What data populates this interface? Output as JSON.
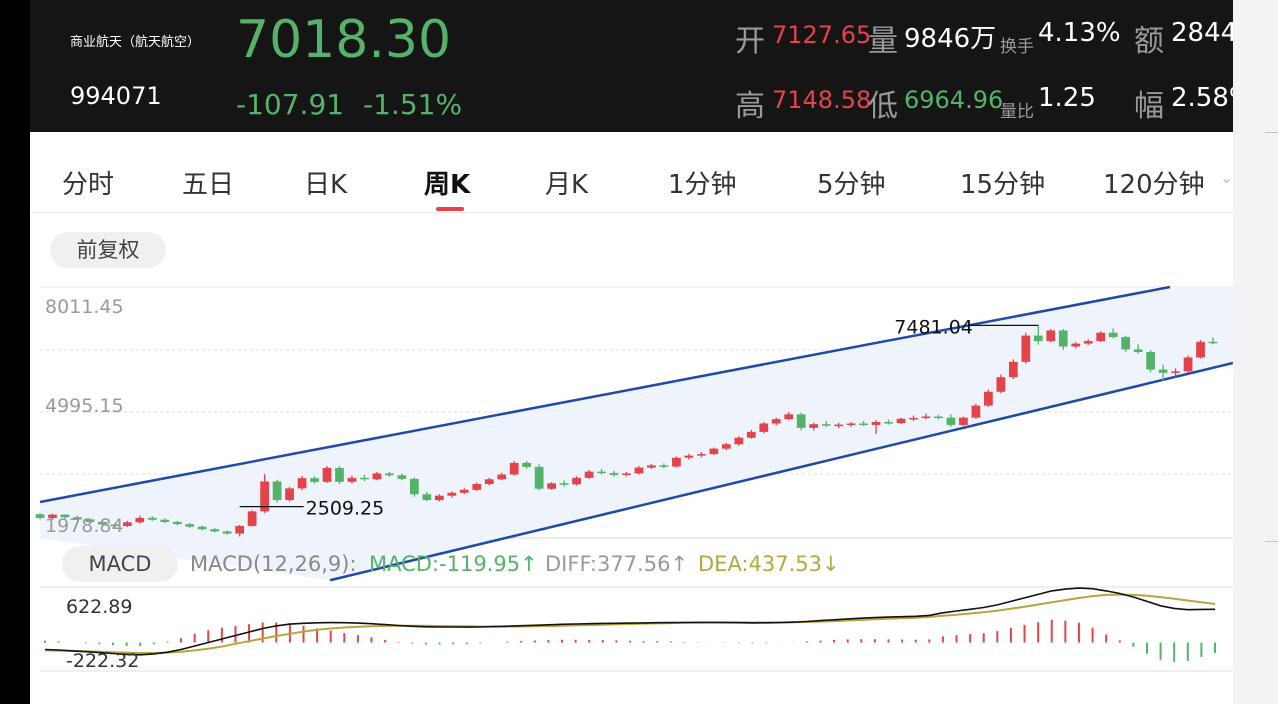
{
  "quote": {
    "name": "商业航天（航天航空）",
    "code": "994071",
    "price": "7018.30",
    "change_abs": "-107.91",
    "change_pct": "-1.51%",
    "open_label": "开",
    "open": "7127.65",
    "volume_label": "量",
    "volume": "9846万",
    "turnover_label": "换手",
    "turnover": "4.13%",
    "amount_label": "额",
    "amount": "2844",
    "high_label": "高",
    "high": "7148.58",
    "low_label": "低",
    "low": "6964.96",
    "ratio_label": "量比",
    "ratio": "1.25",
    "amplitude_label": "幅",
    "amplitude": "2.58%"
  },
  "tabs": [
    "分时",
    "五日",
    "日K",
    "周K",
    "月K",
    "1分钟",
    "5分钟",
    "15分钟",
    "120分钟"
  ],
  "active_tab": "周K",
  "adjust_label": "前复权",
  "kline": {
    "y_top_label": "8011.45",
    "y_mid_label": "4995.15",
    "y_bottom_label": "1978.84",
    "max_annotation": "7481.04",
    "min_annotation": "2509.25"
  },
  "macd": {
    "button_label": "MACD",
    "params": "MACD(12,26,9):",
    "macd_text": "MACD:-119.95↑",
    "diff_text": "DIFF:377.56↑",
    "dea_text": "DEA:437.53↓",
    "top_label": "622.89",
    "bottom_label": "-222.32"
  },
  "colors": {
    "up": "#e5434a",
    "down": "#54b369",
    "channel": "#1f4aa8",
    "channel_fill": "#eef3fc",
    "dea": "#b8a63a",
    "diff": "#111111"
  },
  "chart_data": [
    {
      "type": "candlestick",
      "period": "weekly",
      "y_ticks": [
        8011.45,
        4995.15,
        1978.84
      ],
      "ohlc": [
        [
          2300,
          2330,
          2160,
          2200
        ],
        [
          2200,
          2320,
          2150,
          2290
        ],
        [
          2290,
          2300,
          2180,
          2220
        ],
        [
          2220,
          2260,
          2120,
          2160
        ],
        [
          2160,
          2190,
          2050,
          2090
        ],
        [
          2090,
          2120,
          1990,
          2020
        ],
        [
          2020,
          2060,
          1940,
          1980
        ],
        [
          1980,
          2120,
          1950,
          2080
        ],
        [
          2080,
          2260,
          2040,
          2200
        ],
        [
          2200,
          2250,
          2120,
          2150
        ],
        [
          2150,
          2190,
          2060,
          2090
        ],
        [
          2090,
          2120,
          2000,
          2030
        ],
        [
          2030,
          2060,
          1930,
          1960
        ],
        [
          1960,
          1990,
          1860,
          1890
        ],
        [
          1890,
          1920,
          1800,
          1830
        ],
        [
          1830,
          1860,
          1740,
          1770
        ],
        [
          1770,
          2010,
          1690,
          1980
        ],
        [
          1980,
          2410,
          1960,
          2380
        ],
        [
          2380,
          3400,
          2330,
          3200
        ],
        [
          3200,
          3250,
          2620,
          2690
        ],
        [
          2690,
          3050,
          2650,
          3010
        ],
        [
          3010,
          3350,
          2960,
          3290
        ],
        [
          3290,
          3340,
          3140,
          3190
        ],
        [
          3190,
          3620,
          3160,
          3570
        ],
        [
          3570,
          3620,
          3130,
          3190
        ],
        [
          3190,
          3360,
          3140,
          3300
        ],
        [
          3300,
          3380,
          3210,
          3260
        ],
        [
          3260,
          3460,
          3230,
          3420
        ],
        [
          3420,
          3470,
          3330,
          3370
        ],
        [
          3370,
          3420,
          3230,
          3270
        ],
        [
          3270,
          3310,
          2780,
          2850
        ],
        [
          2850,
          2910,
          2660,
          2690
        ],
        [
          2690,
          2850,
          2650,
          2810
        ],
        [
          2810,
          2930,
          2760,
          2890
        ],
        [
          2890,
          3010,
          2850,
          2970
        ],
        [
          2970,
          3170,
          2940,
          3130
        ],
        [
          3130,
          3300,
          3090,
          3260
        ],
        [
          3260,
          3440,
          3230,
          3390
        ],
        [
          3390,
          3760,
          3360,
          3710
        ],
        [
          3710,
          3760,
          3550,
          3600
        ],
        [
          3600,
          3670,
          2960,
          3000
        ],
        [
          3000,
          3180,
          2970,
          3150
        ],
        [
          3150,
          3230,
          3060,
          3120
        ],
        [
          3120,
          3340,
          3090,
          3300
        ],
        [
          3300,
          3520,
          3270,
          3470
        ],
        [
          3470,
          3540,
          3390,
          3430
        ],
        [
          3430,
          3490,
          3330,
          3380
        ],
        [
          3380,
          3460,
          3340,
          3420
        ],
        [
          3420,
          3620,
          3390,
          3580
        ],
        [
          3580,
          3680,
          3540,
          3640
        ],
        [
          3640,
          3700,
          3560,
          3610
        ],
        [
          3610,
          3890,
          3580,
          3850
        ],
        [
          3850,
          3960,
          3800,
          3910
        ],
        [
          3910,
          4010,
          3860,
          3950
        ],
        [
          3950,
          4130,
          3920,
          4100
        ],
        [
          4100,
          4260,
          4060,
          4220
        ],
        [
          4220,
          4440,
          4180,
          4400
        ],
        [
          4400,
          4610,
          4370,
          4560
        ],
        [
          4560,
          4830,
          4520,
          4790
        ],
        [
          4790,
          4950,
          4740,
          4910
        ],
        [
          4910,
          5100,
          4880,
          5040
        ],
        [
          5040,
          5090,
          4600,
          4670
        ],
        [
          4670,
          4810,
          4600,
          4770
        ],
        [
          4770,
          4860,
          4700,
          4730
        ],
        [
          4730,
          4810,
          4660,
          4760
        ],
        [
          4760,
          4830,
          4700,
          4790
        ],
        [
          4790,
          4860,
          4720,
          4750
        ],
        [
          4750,
          4880,
          4500,
          4830
        ],
        [
          4830,
          4900,
          4760,
          4800
        ],
        [
          4800,
          4950,
          4780,
          4920
        ],
        [
          4920,
          5010,
          4860,
          4940
        ],
        [
          4940,
          5060,
          4900,
          4980
        ],
        [
          4980,
          5030,
          4900,
          4950
        ],
        [
          4950,
          5040,
          4700,
          4750
        ],
        [
          4750,
          4980,
          4720,
          4950
        ],
        [
          4950,
          5330,
          4920,
          5280
        ],
        [
          5280,
          5720,
          5250,
          5660
        ],
        [
          5660,
          6130,
          5620,
          6060
        ],
        [
          6060,
          6550,
          6010,
          6480
        ],
        [
          6480,
          7280,
          6430,
          7200
        ],
        [
          7200,
          7481.04,
          6950,
          7050
        ],
        [
          7050,
          7380,
          7010,
          7340
        ],
        [
          7340,
          7380,
          6810,
          6900
        ],
        [
          6900,
          7020,
          6850,
          6980
        ],
        [
          6980,
          7100,
          6940,
          7050
        ],
        [
          7050,
          7320,
          7020,
          7280
        ],
        [
          7280,
          7400,
          7120,
          7160
        ],
        [
          7160,
          7200,
          6760,
          6820
        ],
        [
          6820,
          6960,
          6700,
          6750
        ],
        [
          6750,
          6800,
          6190,
          6270
        ],
        [
          6270,
          6400,
          5950,
          6180
        ],
        [
          6180,
          6300,
          6050,
          6220
        ],
        [
          6220,
          6650,
          6180,
          6600
        ],
        [
          6600,
          7080,
          6570,
          7030
        ],
        [
          7030,
          7148.58,
          6964.96,
          7018.3
        ]
      ],
      "annotations": {
        "max": 7481.04,
        "min": 2509.25
      },
      "channel": "ascending"
    },
    {
      "type": "bar+line",
      "title": "MACD(12,26,9)",
      "y_ticks": [
        622.89,
        -222.32
      ],
      "series": [
        {
          "name": "DIFF",
          "values": [
            -80,
            -85,
            -95,
            -105,
            -115,
            -125,
            -135,
            -140,
            -130,
            -110,
            -80,
            -40,
            0,
            40,
            80,
            120,
            160,
            190,
            210,
            220,
            225,
            228,
            226,
            222,
            215,
            205,
            195,
            185,
            180,
            178,
            177,
            176,
            178,
            182,
            187,
            192,
            197,
            202,
            208,
            212,
            215,
            218,
            220,
            222,
            224,
            226,
            228,
            229,
            230,
            230,
            228,
            226,
            224,
            225,
            228,
            232,
            240,
            250,
            260,
            270,
            278,
            285,
            290,
            295,
            300,
            310,
            340,
            360,
            380,
            400,
            430,
            470,
            510,
            550,
            590,
            610,
            622,
            615,
            590,
            560,
            520,
            470,
            420,
            390,
            375,
            378,
            380
          ]
        },
        {
          "name": "DEA",
          "values": [
            -90,
            -92,
            -95,
            -100,
            -105,
            -110,
            -115,
            -120,
            -120,
            -115,
            -105,
            -90,
            -70,
            -45,
            -15,
            15,
            45,
            75,
            100,
            125,
            145,
            160,
            172,
            180,
            186,
            190,
            192,
            192,
            191,
            189,
            187,
            185,
            183,
            182,
            182,
            183,
            185,
            188,
            192,
            196,
            200,
            204,
            208,
            212,
            216,
            219,
            222,
            225,
            228,
            229,
            230,
            230,
            229,
            229,
            229,
            231,
            234,
            239,
            245,
            252,
            259,
            266,
            272,
            278,
            284,
            292,
            305,
            318,
            332,
            347,
            365,
            386,
            409,
            434,
            460,
            485,
            509,
            530,
            544,
            548,
            544,
            534,
            519,
            500,
            480,
            460,
            440
          ]
        },
        {
          "name": "MACD",
          "values": [
            20,
            14,
            0,
            -10,
            -20,
            -30,
            -40,
            -40,
            -20,
            10,
            50,
            100,
            140,
            170,
            190,
            210,
            230,
            230,
            220,
            190,
            160,
            136,
            108,
            84,
            58,
            30,
            6,
            -14,
            -22,
            -22,
            -20,
            -18,
            -10,
            0,
            10,
            18,
            24,
            28,
            32,
            32,
            30,
            28,
            24,
            20,
            16,
            14,
            12,
            8,
            4,
            2,
            -4,
            -8,
            -10,
            -8,
            -2,
            2,
            12,
            22,
            30,
            36,
            38,
            38,
            36,
            34,
            32,
            36,
            70,
            84,
            96,
            106,
            130,
            168,
            202,
            232,
            260,
            250,
            226,
            170,
            92,
            24,
            -48,
            -128,
            -198,
            -220,
            -210,
            -164,
            -120
          ]
        }
      ]
    }
  ]
}
